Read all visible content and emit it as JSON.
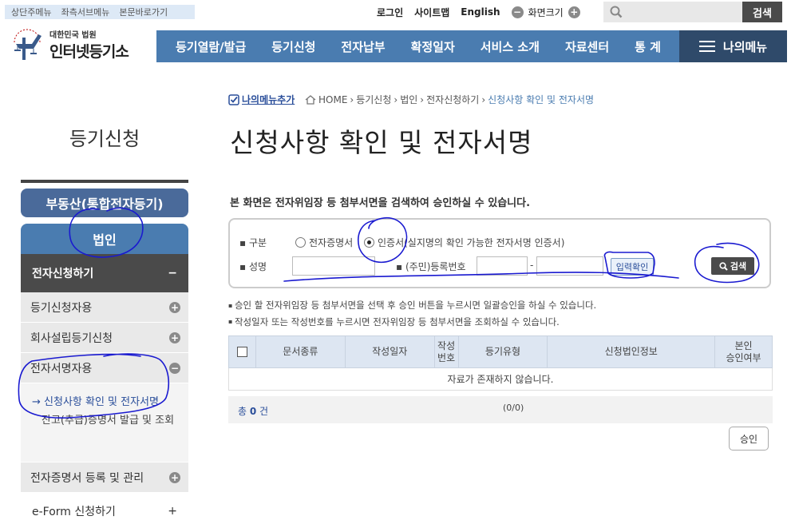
{
  "skip_links": [
    "상단주메뉴",
    "좌측서브메뉴",
    "본문바로가기"
  ],
  "util": {
    "login": "로그인",
    "sitemap": "사이트맵",
    "english": "English",
    "zoom_label": "화면크기",
    "zoom_out": "−",
    "zoom_in": "+"
  },
  "search": {
    "placeholder": "",
    "button": "검색"
  },
  "logo": {
    "line1": "대한민국 법원",
    "line2": "인터넷등기소",
    "seal_text": "대 한 민 국 법 원"
  },
  "gnb": [
    "등기열람/발급",
    "등기신청",
    "전자납부",
    "확정일자",
    "서비스 소개",
    "자료센터",
    "통 계"
  ],
  "mymenu": "나의메뉴",
  "lnb": {
    "title": "등기신청",
    "dep1_realestate": "부동산(통합전자등기)",
    "dep1_corp": "법인",
    "section": "전자신청하기",
    "section_toggle": "−",
    "items": [
      {
        "label": "등기신청자용",
        "toggle": "+"
      },
      {
        "label": "회사설립등기신청",
        "toggle": "+"
      },
      {
        "label": "전자서명자용",
        "toggle": "−"
      }
    ],
    "sub_active": "→ 신청사항 확인 및 전자서명",
    "sub_other": "잔고(추급)증명서 발급 및 조회",
    "cert": {
      "label": "전자증명서 등록 및 관리",
      "toggle": "+"
    },
    "eform": {
      "label": "e-Form 신청하기",
      "toggle": "+"
    }
  },
  "mymenu_add": "나의메뉴추가",
  "breadcrumb": [
    "HOME",
    "등기신청",
    "법인",
    "전자신청하기",
    "신청사항 확인 및 전자서명"
  ],
  "breadcrumb_sep": "›",
  "page_title": "신청사항 확인 및 전자서명",
  "intro": "본 화면은 전자위임장 등 첨부서면을 검색하여 승인하실 수 있습니다.",
  "form": {
    "type_label": "구분",
    "opt1": "전자증명서",
    "opt2": "인증서(실지명의 확인 가능한 전자서명 인증서)",
    "name_label": "성명",
    "reg_label": "(주민)등록번호",
    "reg_sep": "-",
    "confirm_button": "입력확인",
    "search_button": "검색"
  },
  "notes": [
    "승인 할 전자위임장 등 첨부서면을 선택 후 승인 버튼을 누르시면 일괄승인을 하실 수 있습니다.",
    "작성일자 또는 작성번호를 누르시면 전자위임장 등 첨부서면을 조회하실 수 있습니다."
  ],
  "table": {
    "headers": [
      "문서종류",
      "작성일자",
      "작성\n번호",
      "등기유형",
      "신청법인정보",
      "본인\n승인여부"
    ],
    "empty": "자료가 존재하지 않습니다."
  },
  "total": {
    "prefix": "총 ",
    "count": "0",
    "suffix": " 건"
  },
  "page_info": "(0/0)",
  "approve_button": "승인",
  "colors": {
    "gnb": "#4a7cb0",
    "mymenu": "#2f4a6a",
    "annotation": "#1a1ad0"
  }
}
